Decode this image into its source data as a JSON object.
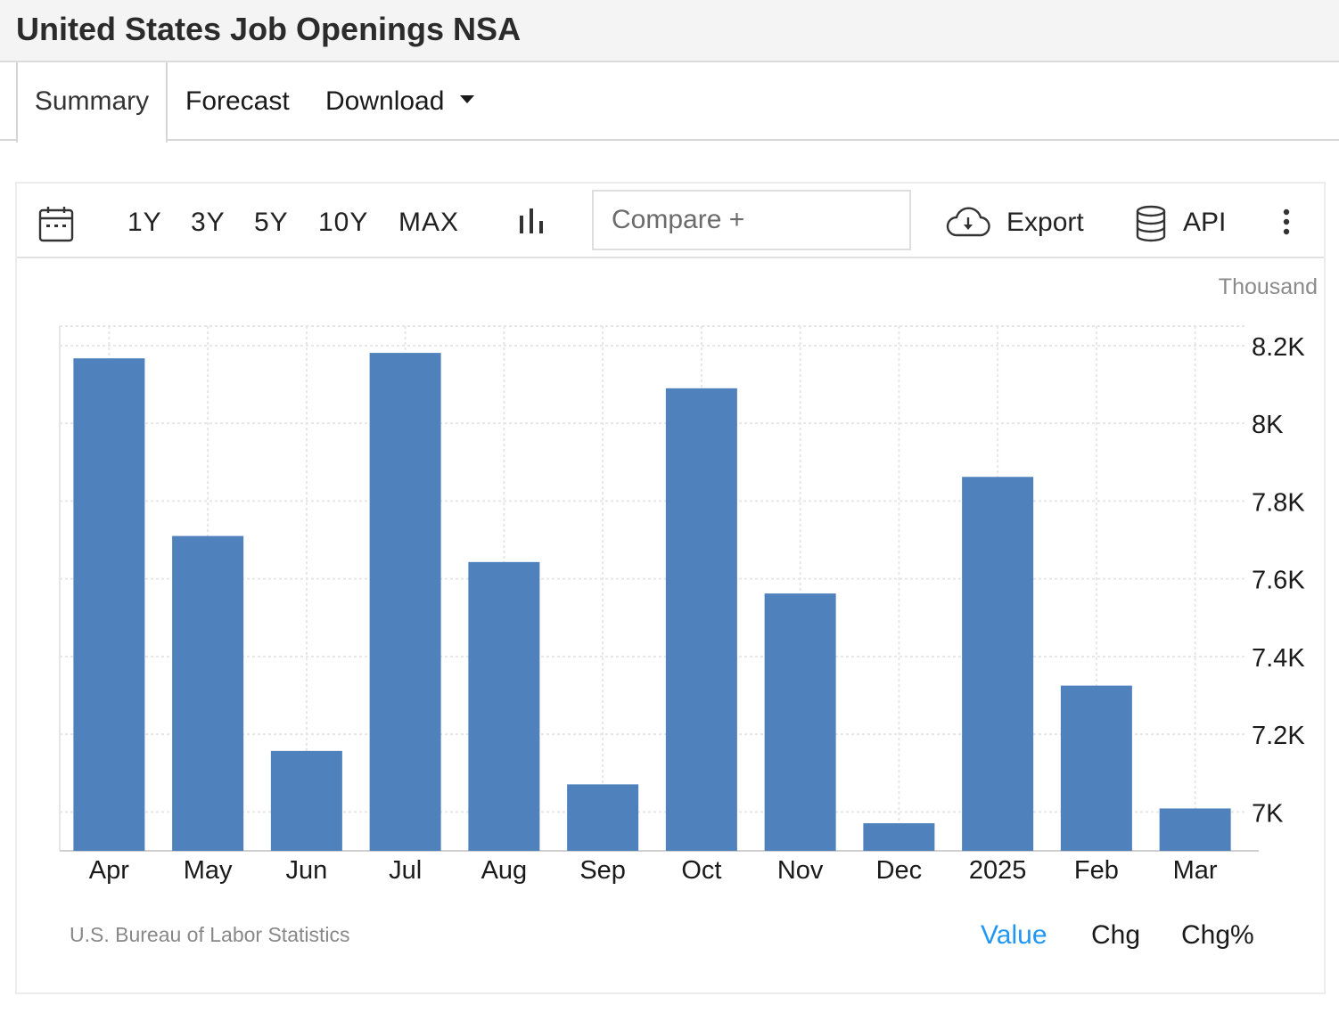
{
  "header": {
    "title": "United States Job Openings NSA"
  },
  "tabs": [
    {
      "label": "Summary",
      "active": true
    },
    {
      "label": "Forecast",
      "active": false
    },
    {
      "label": "Download",
      "active": false,
      "has_dropdown": true
    }
  ],
  "toolbar": {
    "calendar_icon": "calendar-icon",
    "ranges": [
      "1Y",
      "3Y",
      "5Y",
      "10Y",
      "MAX"
    ],
    "chart_type_icon": "bar-chart-icon",
    "compare_placeholder": "Compare +",
    "export_label": "Export",
    "export_icon": "cloud-download-icon",
    "api_label": "API",
    "api_icon": "database-icon",
    "more_icon": "more-vertical-icon"
  },
  "chart_data": {
    "type": "bar",
    "title": "",
    "unit_label": "Thousand",
    "categories": [
      "Apr",
      "May",
      "Jun",
      "Jul",
      "Aug",
      "Sep",
      "Oct",
      "Nov",
      "Dec",
      "2025",
      "Feb",
      "Mar"
    ],
    "series": [
      {
        "values": [
          8167,
          7710,
          7157,
          8181,
          7643,
          7071,
          8090,
          7562,
          6971,
          7862,
          7325,
          7009
        ]
      }
    ],
    "ylim": [
      6900,
      8250
    ],
    "yticks": [
      7000,
      7200,
      7400,
      7600,
      7800,
      8000,
      8200
    ],
    "ytick_labels": [
      "7K",
      "7.2K",
      "7.4K",
      "7.6K",
      "7.8K",
      "8K",
      "8.2K"
    ],
    "y_axis_position": "right",
    "grid": true,
    "bar_color": "#4f81bd"
  },
  "footer": {
    "source": "U.S. Bureau of Labor Statistics",
    "view_options": [
      "Value",
      "Chg",
      "Chg%"
    ],
    "active_view": "Value",
    "active_color": "#2196f3"
  }
}
